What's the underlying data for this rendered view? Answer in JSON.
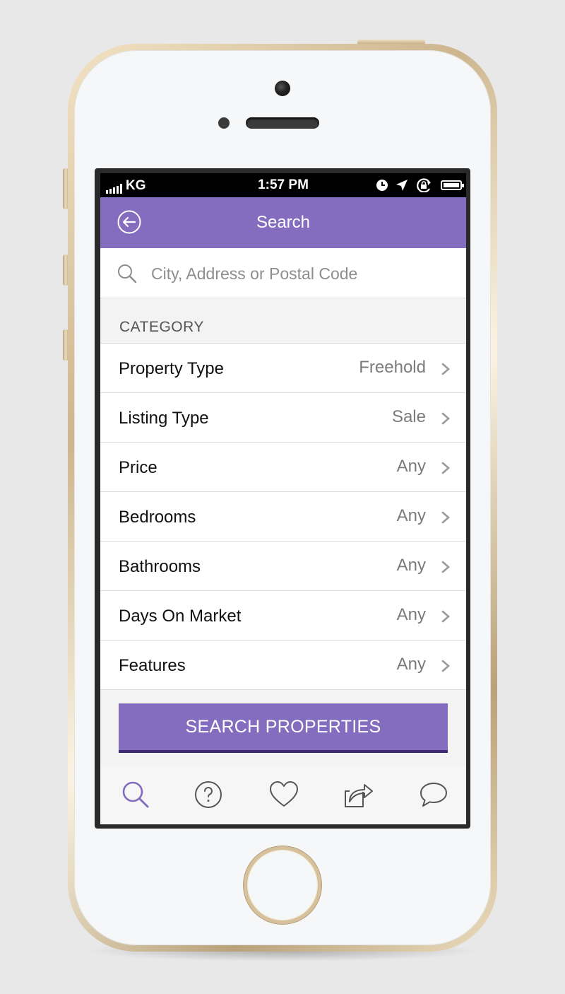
{
  "status_bar": {
    "carrier": "KG",
    "time": "1:57 PM"
  },
  "nav": {
    "title": "Search",
    "back_icon": "back-arrow-circle-icon"
  },
  "search": {
    "placeholder": "City, Address or Postal Code",
    "value": ""
  },
  "category": {
    "header": "CATEGORY",
    "rows": [
      {
        "label": "Property Type",
        "value": "Freehold"
      },
      {
        "label": "Listing Type",
        "value": "Sale"
      },
      {
        "label": "Price",
        "value": "Any"
      },
      {
        "label": "Bedrooms",
        "value": "Any"
      },
      {
        "label": "Bathrooms",
        "value": "Any"
      },
      {
        "label": "Days On Market",
        "value": "Any"
      },
      {
        "label": "Features",
        "value": "Any"
      }
    ]
  },
  "action": {
    "button_label": "SEARCH PROPERTIES"
  },
  "tabbar": {
    "tabs": [
      {
        "icon": "search-icon",
        "active": true
      },
      {
        "icon": "help-icon",
        "active": false
      },
      {
        "icon": "heart-icon",
        "active": false
      },
      {
        "icon": "share-icon",
        "active": false
      },
      {
        "icon": "chat-icon",
        "active": false
      }
    ]
  },
  "colors": {
    "accent": "#846cbf",
    "accent_dark": "#3c2b73",
    "background": "#f3f3f3"
  }
}
